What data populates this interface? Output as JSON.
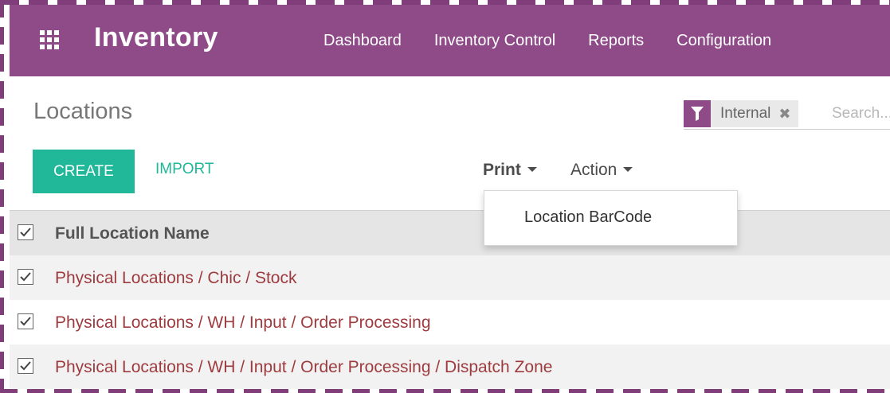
{
  "navbar": {
    "brand": "Inventory",
    "menu": [
      {
        "label": "Dashboard"
      },
      {
        "label": "Inventory Control"
      },
      {
        "label": "Reports"
      },
      {
        "label": "Configuration"
      }
    ]
  },
  "control_panel": {
    "title": "Locations",
    "search": {
      "facet": "Internal",
      "placeholder": "Search..."
    },
    "buttons": {
      "create": "Create",
      "import": "Import"
    },
    "dropdowns": {
      "print": "Print",
      "action": "Action"
    }
  },
  "dropdown_menu": {
    "items": [
      {
        "label": "Location BarCode"
      }
    ]
  },
  "list": {
    "header": "Full Location Name",
    "rows": [
      {
        "name": "Physical Locations / Chic / Stock",
        "checked": true
      },
      {
        "name": "Physical Locations / WH / Input / Order Processing",
        "checked": true
      },
      {
        "name": "Physical Locations / WH / Input / Order Processing / Dispatch Zone",
        "checked": true
      }
    ]
  },
  "colors": {
    "brand": "#8f4a88",
    "primary_button": "#21b799",
    "link_text": "#9e3b3f"
  }
}
